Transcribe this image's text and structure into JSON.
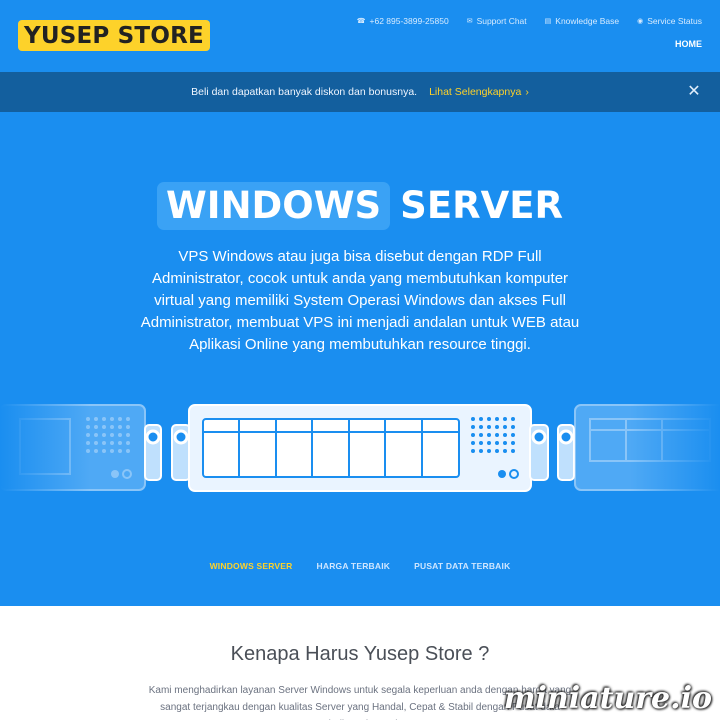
{
  "brand": {
    "logo_text": "YUSEP STORE"
  },
  "topbar": {
    "links": [
      {
        "icon": "phone-icon",
        "label": "+62 895-3899-25850"
      },
      {
        "icon": "chat-icon",
        "label": "Support Chat"
      },
      {
        "icon": "book-icon",
        "label": "Knowledge Base"
      },
      {
        "icon": "status-icon",
        "label": "Service Status"
      }
    ],
    "home_label": "HOME"
  },
  "announcement": {
    "text": "Beli dan dapatkan banyak diskon dan bonusnya.",
    "link_label": "Lihat Selengkapnya",
    "close_icon": "close-icon"
  },
  "hero": {
    "title_highlight": "WINDOWS",
    "title_rest": "SERVER",
    "description": "VPS Windows atau juga bisa disebut dengan RDP Full Administrator, cocok untuk anda yang membutuhkan komputer virtual yang memiliki System Operasi Windows dan akses Full Administrator, membuat VPS ini menjadi andalan untuk WEB atau Aplikasi Online yang membutuhkan resource tinggi.",
    "tabs": [
      {
        "label": "WINDOWS SERVER",
        "active": true
      },
      {
        "label": "HARGA TERBAIK",
        "active": false
      },
      {
        "label": "PUSAT DATA TERBAIK",
        "active": false
      }
    ]
  },
  "section": {
    "title": "Kenapa Harus Yusep Store ?",
    "text": "Kami menghadirkan layanan Server Windows untuk segala keperluan anda dengan harga yang sangat terjangkau dengan kualitas Server yang Handal, Cepat & Stabil dengan Pusat data terbaik Dari Google"
  },
  "watermark": "miniature.io",
  "colors": {
    "primary": "#1a8ef0",
    "announce_bg": "#135f9e",
    "accent": "#fdd22a"
  }
}
